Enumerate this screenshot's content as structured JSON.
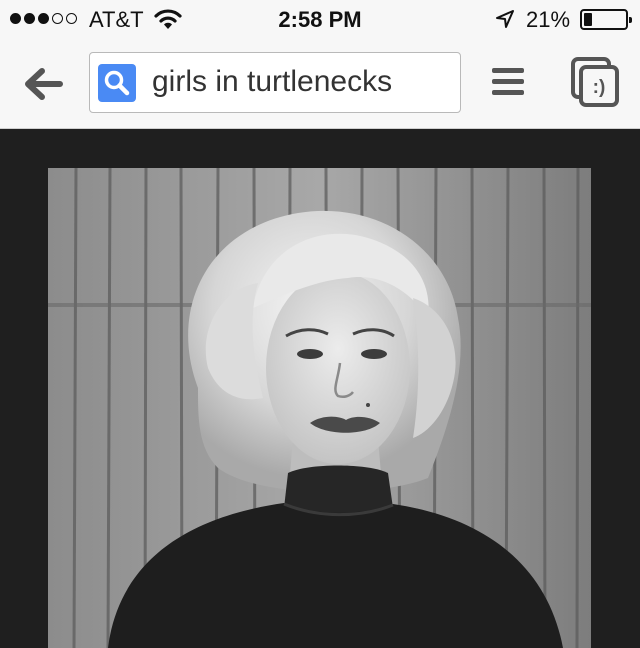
{
  "status_bar": {
    "signal_bars_filled": 3,
    "signal_bars_total": 5,
    "carrier": "AT&T",
    "time": "2:58 PM",
    "battery_percent_text": "21%",
    "battery_level": 0.21,
    "icons": [
      "wifi-icon",
      "location-arrow-icon",
      "battery-icon"
    ]
  },
  "toolbar": {
    "back_icon": "back-arrow-icon",
    "search_icon": "search-icon",
    "search_query": "girls in turtlenecks",
    "menu_icon": "menu-icon",
    "tabs_icon": "tabs-icon"
  },
  "result": {
    "image_subject": "black and white photo of woman in turtleneck"
  },
  "colors": {
    "bar_background": "#f7f7f7",
    "search_accent": "#4a8af4",
    "content_background": "#1f1f1f"
  }
}
